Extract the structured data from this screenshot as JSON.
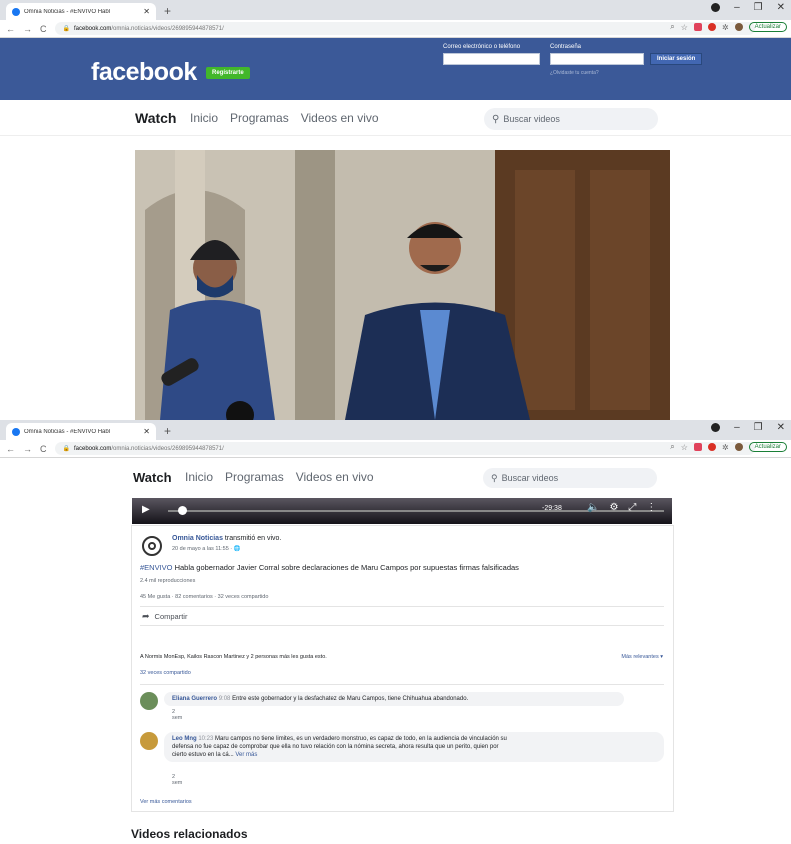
{
  "browser": {
    "tab_title": "Omnia Noticias - #ENVIVO Habl",
    "new_tab": "+",
    "url_host": "facebook.com",
    "url_path": "/omnia.noticias/videos/269895944878571/",
    "update_label": "Actualizar"
  },
  "facebook": {
    "logo": "facebook",
    "signup": "Regístrarte",
    "email_label": "Correo electrónico o teléfono",
    "password_label": "Contraseña",
    "forgot": "¿Olvidaste tu cuenta?",
    "login": "Iniciar sesión"
  },
  "watch_nav": {
    "title": "Watch",
    "links": [
      "Inicio",
      "Programas",
      "Videos en vivo"
    ],
    "search_placeholder": "Buscar videos"
  },
  "player": {
    "time": "-29:38",
    "progress": 0.02
  },
  "post": {
    "page_name": "Omnia Noticias",
    "action": "transmitió en vivo.",
    "date": "20 de mayo a las 11:55 · ",
    "hashtag": "#ENVIVO",
    "text": " Habla gobernador Javier Corral sobre declaraciones de Maru Campos por supuestas firmas falsificadas",
    "views": "2.4 mil reproducciones",
    "counts": "45 Me gusta · 82 comentarios · 32 veces compartido",
    "share": "Compartir",
    "likes_line": "A Normis MonEsp, Kailos Rascon Martinez y 2 personas más les gusta esto.",
    "sort": "Más relevantes ▾",
    "shared": "32 veces compartido",
    "more_comments": "Ver más comentarios"
  },
  "comments": [
    {
      "author": "Eliana Guerrero",
      "time": "9:08",
      "text": "Entre este gobernador y la desfachatez de Maru Campos, tiene Chihuahua abandonado.",
      "age": "2 sem"
    },
    {
      "author": "Leo Mng",
      "time": "10:23",
      "text_1": "Maru campos no tiene limites, es un verdadero monstruo, es capaz de todo, en la audiencia de vinculación su",
      "text_2": "defensa no fue capaz de comprobar que ella no tuvo relación con la nómina secreta, ahora resulta que un perito, quien por",
      "text_3": "cierto estuvo en la cá...",
      "more": "Ver más",
      "age": "2 sem"
    }
  ],
  "related": "Videos relacionados",
  "colors": {
    "fb_blue": "#3b5998",
    "signup_green": "#42b72a",
    "link_blue": "#385898"
  }
}
